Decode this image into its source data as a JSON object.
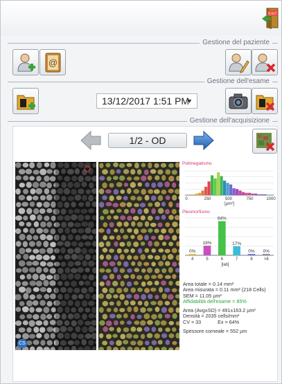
{
  "sections": {
    "patient": "Gestione del paziente",
    "exam": "Gestione dell'esame",
    "acquisition": "Gestione dell'acquisizione"
  },
  "exam_date": "13/12/2017 1:51 PM",
  "image_nav": "1/2 - OD",
  "exit_label": "EXIT",
  "image_badge": "CS",
  "stats": {
    "area_totale": "Area totale = 0.14 mm²",
    "area_misurata": "Area misurata = 0.11 mm² (218 Cells)",
    "sem": "SEM = 11.05 µm²",
    "affidabilita": "Affidabilità dell'esame = 85%",
    "area_avg": "Area (Avg±SD) = 491±163.2 µm²",
    "densita": "Densità = 2035 cells/mm²",
    "cv_ex": "CV = 33            Ex = 64%",
    "spessore": "Spessore corneale = 552 µm"
  },
  "chart_data": [
    {
      "type": "bar",
      "title": "Polimegatismo",
      "x_ticks": [
        "0",
        "250",
        "500",
        "750",
        "1000"
      ],
      "xlabel": "[µm²]",
      "xlim": [
        0,
        1000
      ],
      "values": [
        1,
        2,
        3,
        6,
        11,
        18,
        26,
        22,
        30,
        25,
        19,
        16,
        14,
        9,
        8,
        6,
        4,
        3,
        3,
        2,
        2,
        1,
        1,
        1
      ],
      "colors": [
        "#c8c53a",
        "#d4b537",
        "#e0a03a",
        "#e07a3c",
        "#e25a4a",
        "#e8414f",
        "#3dbb4f",
        "#5fcc49",
        "#a6d64a",
        "#3fb85b",
        "#2e8fb3",
        "#4a9fd4",
        "#6b6fd2",
        "#8a5ac9",
        "#a14db8",
        "#b94ca7",
        "#c7489a",
        "#d04d8c",
        "#c94b91",
        "#bf4aa0",
        "#a74cb3",
        "#8d4fc1",
        "#6f53c8",
        "#5a5acc"
      ]
    },
    {
      "type": "bar",
      "title": "Pleomorfismo",
      "categories": [
        "4",
        "5",
        "6",
        "7",
        "8",
        ">8"
      ],
      "values": [
        0,
        18,
        64,
        17,
        0,
        0
      ],
      "labels": [
        "0%",
        "18%",
        "64%",
        "17%",
        "0%",
        "0%"
      ],
      "xlabel": "[lati]",
      "ylim": [
        0,
        70
      ],
      "colors": [
        "#e0be40",
        "#c84fc0",
        "#44c24a",
        "#3ebbd8",
        "#6e7bd6",
        "#8a8fa8"
      ]
    }
  ]
}
